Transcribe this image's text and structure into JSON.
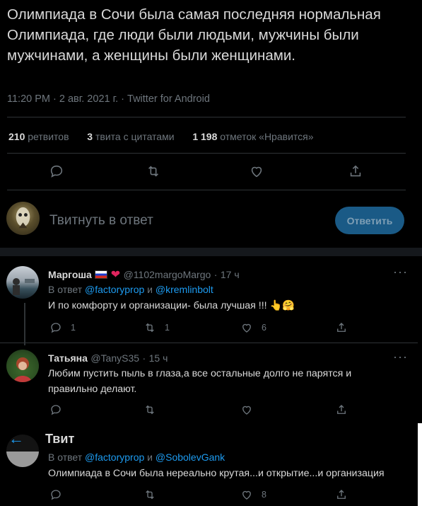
{
  "tweet": {
    "text": "Олимпиада в Сочи была самая последняя нормальная Олимпиада, где люди были людьми, мужчины были мужчинами, а женщины были женщинами.",
    "meta": "11:20 PM · 2 авг. 2021 г. · Twitter for Android"
  },
  "stats": {
    "retweets_count": "210",
    "retweets_label": "ретвитов",
    "quotes_count": "3",
    "quotes_label": "твита с цитатами",
    "likes_count": "1 198",
    "likes_label": "отметок «Нравится»"
  },
  "compose": {
    "placeholder": "Твитнуть в ответ",
    "reply_button": "Ответить"
  },
  "replies": [
    {
      "name": "Маргоша",
      "handle": "@1102margoMargo",
      "time": "17 ч",
      "reply_to_prefix": "В ответ",
      "reply_to_user1": "@factoryprop",
      "reply_to_and": "и",
      "reply_to_user2": "@kremlinbolt",
      "text": "И по комфорту и организации- была лучшая !!! 👆🤗",
      "reply_count": "1",
      "retweet_count": "1",
      "like_count": "6",
      "more": "···"
    },
    {
      "name": "Татьяна",
      "handle": "@TanyS35",
      "time": "15 ч",
      "text_line1": "Любим пустить пыль в глаза,а все остальные долго не парятся и",
      "text_line2": "правильно делают.",
      "more": "···"
    },
    {
      "reply_to_prefix": "В ответ",
      "reply_to_user1": "@factoryprop",
      "reply_to_and": "и",
      "reply_to_user2": "@SobolevGank",
      "text": "Олимпиада в Сочи была нереально крутая...и открытие...и организация",
      "like_count": "8"
    }
  ],
  "header": {
    "back_icon": "←",
    "title": "Твит"
  },
  "colors": {
    "background": "#000000",
    "accent": "#1d9bf0",
    "secondary_text": "#6e767d",
    "like_heart": "#e0245e"
  }
}
